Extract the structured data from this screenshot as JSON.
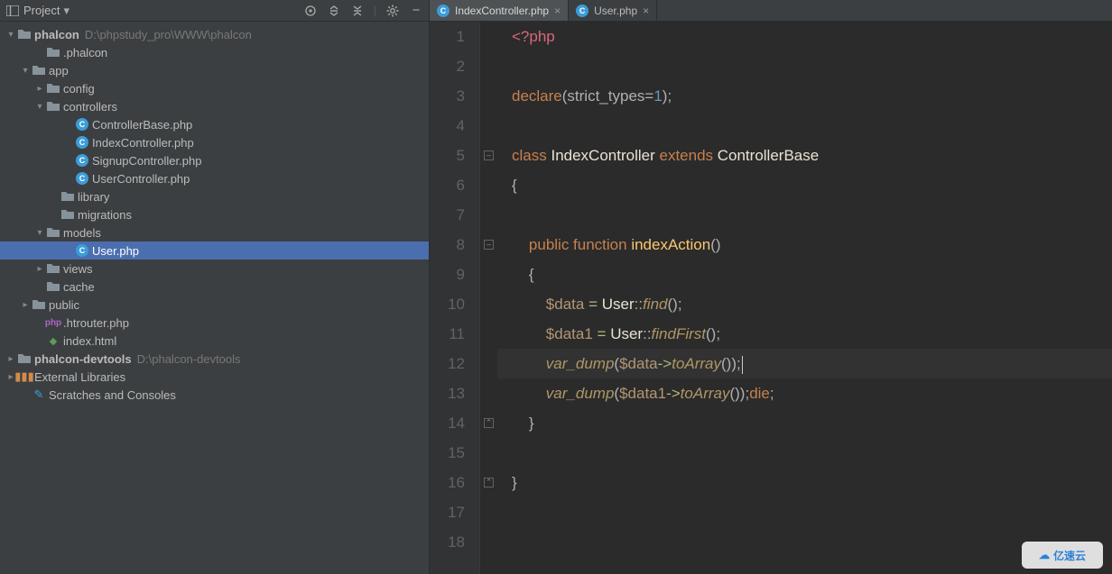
{
  "toolbar": {
    "title": "Project"
  },
  "tree": {
    "phalcon": {
      "label": "phalcon",
      "path": "D:\\phpstudy_pro\\WWW\\phalcon"
    },
    "dot_phalcon": ".phalcon",
    "app": "app",
    "config": "config",
    "controllers": "controllers",
    "controllerBase": "ControllerBase.php",
    "indexController": "IndexController.php",
    "signupController": "SignupController.php",
    "userController": "UserController.php",
    "library": "library",
    "migrations": "migrations",
    "models": "models",
    "userPhp": "User.php",
    "views": "views",
    "cache": "cache",
    "public": "public",
    "htrouter": ".htrouter.php",
    "indexHtml": "index.html",
    "devtools": {
      "label": "phalcon-devtools",
      "path": "D:\\phalcon-devtools"
    },
    "extLib": "External Libraries",
    "scratches": "Scratches and Consoles"
  },
  "tabs": {
    "t1": "IndexController.php",
    "t2": "User.php"
  },
  "code": {
    "lines": [
      "1",
      "2",
      "3",
      "4",
      "5",
      "6",
      "7",
      "8",
      "9",
      "10",
      "11",
      "12",
      "13",
      "14",
      "15",
      "16",
      "17",
      "18"
    ],
    "l1_a": "<?php",
    "l3_a": "declare",
    "l3_b": "(strict_types=",
    "l3_c": "1",
    "l3_d": ");",
    "l5_a": "class ",
    "l5_b": "IndexController ",
    "l5_c": "extends ",
    "l5_d": "ControllerBase",
    "l6": "{",
    "l8_a": "public ",
    "l8_b": "function ",
    "l8_c": "indexAction",
    "l8_d": "()",
    "l9": "{",
    "l10_a": "$data ",
    "l10_b": "= ",
    "l10_c": "User",
    "l10_d": "::",
    "l10_e": "find",
    "l10_f": "();",
    "l11_a": "$data1 ",
    "l11_b": "= ",
    "l11_c": "User",
    "l11_d": "::",
    "l11_e": "findFirst",
    "l11_f": "();",
    "l12_a": "var_dump",
    "l12_b": "(",
    "l12_c": "$data",
    "l12_d": "->",
    "l12_e": "toArray",
    "l12_f": "());",
    "l13_a": "var_dump",
    "l13_b": "(",
    "l13_c": "$data1",
    "l13_d": "->",
    "l13_e": "toArray",
    "l13_f": "());",
    "l13_g": "die",
    "l13_h": ";",
    "l14": "}",
    "l16": "}"
  },
  "watermark": "亿速云"
}
